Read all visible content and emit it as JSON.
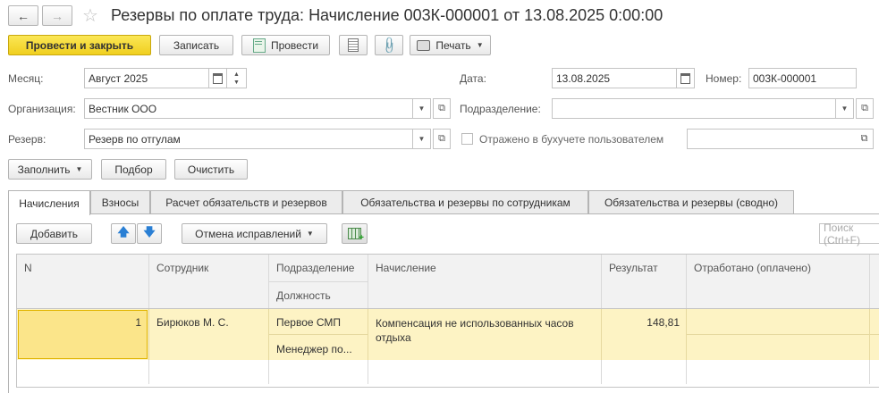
{
  "window": {
    "title": "Резервы по оплате труда: Начисление 003К-000001 от 13.08.2025 0:00:00"
  },
  "toolbar": {
    "post_close": "Провести и закрыть",
    "save": "Записать",
    "post": "Провести",
    "print": "Печать"
  },
  "form": {
    "month_label": "Месяц:",
    "month_value": "Август 2025",
    "date_label": "Дата:",
    "date_value": "13.08.2025",
    "number_label": "Номер:",
    "number_value": "003К-000001",
    "org_label": "Организация:",
    "org_value": "Вестник ООО",
    "dept_label": "Подразделение:",
    "dept_value": "",
    "reserve_label": "Резерв:",
    "reserve_value": "Резерв по отгулам",
    "reflected_label": "Отражено в бухучете пользователем",
    "reflected_value": ""
  },
  "actions": {
    "fill": "Заполнить",
    "select": "Подбор",
    "clear": "Очистить"
  },
  "tabs": [
    {
      "label": "Начисления"
    },
    {
      "label": "Взносы"
    },
    {
      "label": "Расчет обязательств и резервов"
    },
    {
      "label": "Обязательства и резервы по сотрудникам"
    },
    {
      "label": "Обязательства и резервы (сводно)"
    }
  ],
  "table_toolbar": {
    "add": "Добавить",
    "cancel_corrections": "Отмена исправлений",
    "search_placeholder": "Поиск (Ctrl+F)"
  },
  "table": {
    "headers": {
      "n": "N",
      "employee": "Сотрудник",
      "department": "Подразделение",
      "position": "Должность",
      "accrual": "Начисление",
      "result": "Результат",
      "worked": "Отработано (оплачено)"
    },
    "rows": [
      {
        "n": "1",
        "employee": "Бирюков М. С.",
        "department": "Первое СМП",
        "position": "Менеджер по...",
        "accrual": "Компенсация не использованных часов отдыха",
        "result": "148,81",
        "worked": ""
      }
    ]
  },
  "colors": {
    "primary": "#f5d92e",
    "row_selected": "#fdf3c4",
    "cell_active": "#fbe58a"
  }
}
